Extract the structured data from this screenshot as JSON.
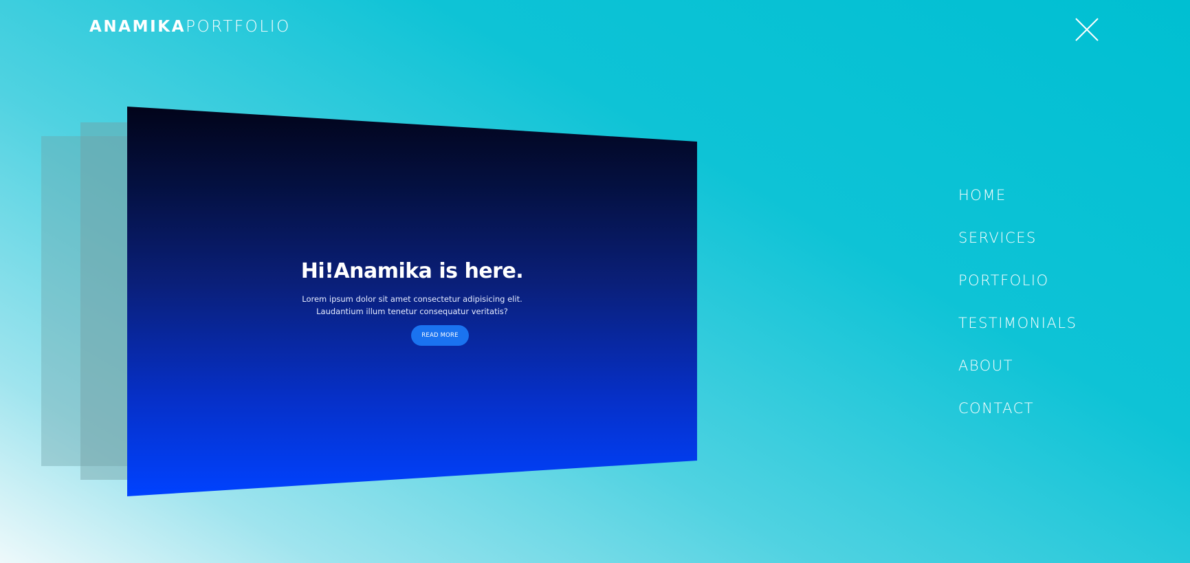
{
  "header": {
    "logo_bold": "ANAMIKA",
    "logo_light": "PORTFOLIO",
    "close_icon": "close-icon"
  },
  "preview": {
    "title": "Hi!Anamika is here.",
    "subtitle_line1": "Lorem ipsum dolor sit amet consectetur adipisicing elit.",
    "subtitle_line2": "Laudantium illum tenetur consequatur veritatis?",
    "button_label": "READ MORE"
  },
  "nav": {
    "items": [
      {
        "label": "HOME"
      },
      {
        "label": "SERVICES"
      },
      {
        "label": "PORTFOLIO"
      },
      {
        "label": "TESTIMONIALS"
      },
      {
        "label": "ABOUT"
      },
      {
        "label": "CONTACT"
      }
    ]
  },
  "colors": {
    "accent": "#00bfd2",
    "button": "#1a73f0",
    "panel_top": "#02041a",
    "panel_bottom": "#0042ff"
  }
}
